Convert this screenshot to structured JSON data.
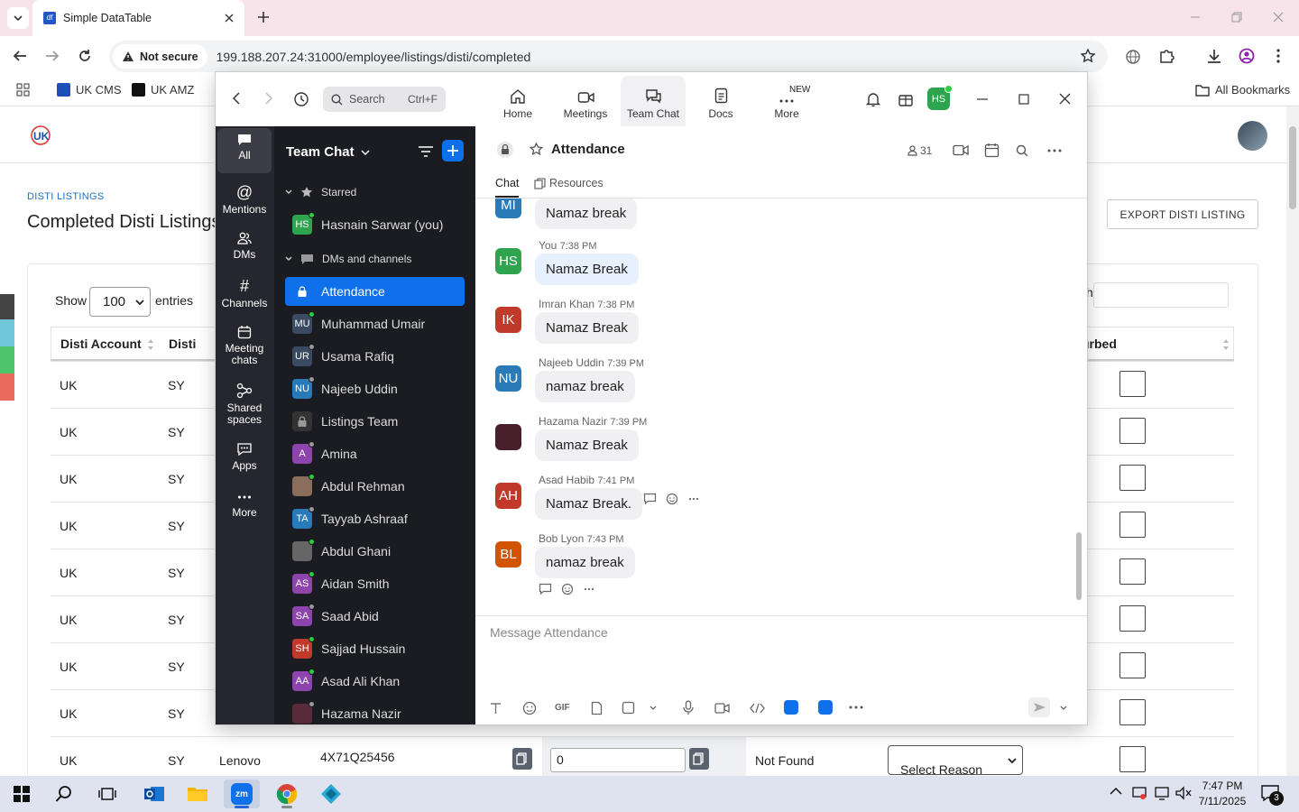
{
  "browser": {
    "tab_title": "Simple DataTable",
    "security_label": "Not secure",
    "url": "199.188.207.24:31000/employee/listings/disti/completed",
    "bookmarks": [
      "UK CMS",
      "UK AMZ"
    ],
    "all_bookmarks": "All Bookmarks"
  },
  "page": {
    "section_label": "DISTI LISTINGS",
    "title": "Completed Disti Listings",
    "export_button": "EXPORT DISTI LISTING",
    "show_label": "Show",
    "entries_value": "100",
    "entries_label": "entries",
    "search_partial": "h",
    "columns": [
      "Disti Account",
      "Disti",
      "urbed"
    ],
    "rows": [
      {
        "account": "UK",
        "disti": "SY"
      },
      {
        "account": "UK",
        "disti": "SY"
      },
      {
        "account": "UK",
        "disti": "SY"
      },
      {
        "account": "UK",
        "disti": "SY"
      },
      {
        "account": "UK",
        "disti": "SY"
      },
      {
        "account": "UK",
        "disti": "SY"
      },
      {
        "account": "UK",
        "disti": "SY"
      },
      {
        "account": "UK",
        "disti": "SY"
      }
    ],
    "last_row": {
      "account": "UK",
      "disti": "SY",
      "brand": "Lenovo",
      "sku": "4X71Q25456",
      "qty": "0",
      "status": "Not Found",
      "reason": "Select Reason"
    }
  },
  "zoom": {
    "search_placeholder": "Search",
    "search_shortcut": "Ctrl+F",
    "nav": [
      {
        "label": "Home",
        "icon": "home-icon"
      },
      {
        "label": "Meetings",
        "icon": "video-icon"
      },
      {
        "label": "Team Chat",
        "icon": "chat-icon"
      },
      {
        "label": "Docs",
        "icon": "docs-icon"
      },
      {
        "label": "More",
        "icon": "more-icon"
      }
    ],
    "new_badge": "NEW",
    "user_initials": "HS",
    "rail": [
      {
        "label": "All"
      },
      {
        "label": "Mentions"
      },
      {
        "label": "DMs"
      },
      {
        "label": "Channels"
      },
      {
        "label": "Meeting chats"
      },
      {
        "label": "Shared spaces"
      },
      {
        "label": "Apps"
      },
      {
        "label": "More"
      }
    ],
    "sidebar": {
      "title": "Team Chat",
      "starred": "Starred",
      "starred_user": {
        "initials": "HS",
        "name": "Hasnain Sarwar (you)",
        "color": "#2ea44f"
      },
      "dms_heading": "DMs and channels",
      "items": [
        {
          "initials": "",
          "name": "Attendance",
          "color": "#0e71eb",
          "status": "lock"
        },
        {
          "initials": "MU",
          "name": "Muhammad Umair",
          "color": "#3a4a63",
          "status": "#2ecc40"
        },
        {
          "initials": "UR",
          "name": "Usama Rafiq",
          "color": "#3a4a63",
          "status": "#999999"
        },
        {
          "initials": "NU",
          "name": "Najeeb Uddin",
          "color": "#2a7ab8",
          "status": "#999999"
        },
        {
          "initials": "",
          "name": "Listings Team",
          "color": "#333333",
          "status": "lock"
        },
        {
          "initials": "A",
          "name": "Amina",
          "color": "#8e44ad",
          "status": "#999999"
        },
        {
          "initials": "",
          "name": "Abdul Rehman",
          "color": "#8a6d5a",
          "status": "#2ecc40"
        },
        {
          "initials": "TA",
          "name": "Tayyab Ashraaf",
          "color": "#2a7ab8",
          "status": "#999999"
        },
        {
          "initials": "",
          "name": "Abdul Ghani",
          "color": "#666666",
          "status": "#2ecc40"
        },
        {
          "initials": "AS",
          "name": "Aidan Smith",
          "color": "#8e44ad",
          "status": "#2ecc40"
        },
        {
          "initials": "SA",
          "name": "Saad Abid",
          "color": "#8e44ad",
          "status": "#999999"
        },
        {
          "initials": "SH",
          "name": "Sajjad Hussain",
          "color": "#c0392b",
          "status": "#2ecc40"
        },
        {
          "initials": "AA",
          "name": "Asad Ali Khan",
          "color": "#8e44ad",
          "status": "#2ecc40"
        },
        {
          "initials": "",
          "name": "Hazama Nazir",
          "color": "#5a2a3a",
          "status": "#999999"
        }
      ]
    },
    "channel": {
      "name": "Attendance",
      "member_count": "31",
      "tabs": [
        "Chat",
        "Resources"
      ],
      "compose_placeholder": "Message Attendance"
    },
    "messages": [
      {
        "initials": "MI",
        "sender": "",
        "time": "",
        "text": "Namaz break",
        "color": "#2a7ab8",
        "me": false
      },
      {
        "initials": "HS",
        "sender": "You",
        "time": "7:38 PM",
        "text": "Namaz Break",
        "color": "#2ea44f",
        "me": true
      },
      {
        "initials": "IK",
        "sender": "Imran Khan",
        "time": "7:38 PM",
        "text": "Namaz Break",
        "color": "#c0392b",
        "me": false
      },
      {
        "initials": "NU",
        "sender": "Najeeb Uddin",
        "time": "7:39 PM",
        "text": "namaz break",
        "color": "#2a7ab8",
        "me": false
      },
      {
        "initials": "",
        "sender": "Hazama Nazir",
        "time": "7:39 PM",
        "text": "Namaz Break",
        "color": "#4a1f2c",
        "me": false
      },
      {
        "initials": "AH",
        "sender": "Asad Habib",
        "time": "7:41 PM",
        "text": "Namaz Break.",
        "color": "#c0392b",
        "me": false
      },
      {
        "initials": "BL",
        "sender": "Bob Lyon",
        "time": "7:43 PM",
        "text": "namaz break",
        "color": "#d35400",
        "me": false
      }
    ],
    "composer_tools": [
      "text-format-icon",
      "emoji-icon",
      "gif-icon",
      "file-icon",
      "screenshot-icon",
      "mic-icon",
      "video-message-icon",
      "code-icon",
      "app-icon-1",
      "app-icon-2",
      "more-icon"
    ],
    "gif_label": "GIF"
  },
  "taskbar": {
    "time": "7:47 PM",
    "date": "7/11/2025",
    "notification_count": "3"
  }
}
